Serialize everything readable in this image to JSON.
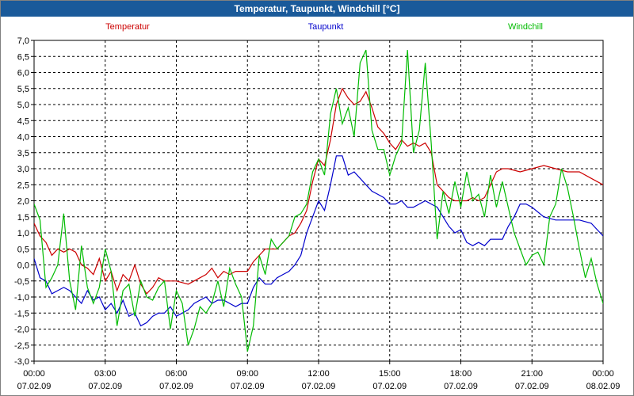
{
  "window": {
    "title": "Temperatur, Taupunkt, Windchill [°C]"
  },
  "chart_data": {
    "type": "line",
    "title": "Temperatur, Taupunkt, Windchill [°C]",
    "ylim": [
      -3.0,
      7.0
    ],
    "ytick_step": 0.5,
    "y_ticks": [
      "7,0",
      "6,5",
      "6,0",
      "5,5",
      "5,0",
      "4,5",
      "4,0",
      "3,5",
      "3,0",
      "2,5",
      "2,0",
      "1,5",
      "1,0",
      "0,5",
      "0,0",
      "-0,5",
      "-1,0",
      "-1,5",
      "-2,0",
      "-2,5",
      "-3,0"
    ],
    "x_unit": "hours since 07.02.09 00:00",
    "xlim": [
      0,
      24
    ],
    "x_ticks": [
      {
        "time": "00:00",
        "date": "07.02.09"
      },
      {
        "time": "03:00",
        "date": "07.02.09"
      },
      {
        "time": "06:00",
        "date": "07.02.09"
      },
      {
        "time": "09:00",
        "date": "07.02.09"
      },
      {
        "time": "12:00",
        "date": "07.02.09"
      },
      {
        "time": "15:00",
        "date": "07.02.09"
      },
      {
        "time": "18:00",
        "date": "07.02.09"
      },
      {
        "time": "21:00",
        "date": "07.02.09"
      },
      {
        "time": "00:00",
        "date": "08.02.09"
      }
    ],
    "grid": true,
    "legend_placement": "top",
    "series": [
      {
        "name": "Temperatur",
        "color": "#cc0000",
        "points": [
          [
            0,
            1.3
          ],
          [
            0.25,
            0.9
          ],
          [
            0.5,
            0.7
          ],
          [
            0.75,
            0.3
          ],
          [
            1,
            0.5
          ],
          [
            1.25,
            0.4
          ],
          [
            1.5,
            0.5
          ],
          [
            1.75,
            0.4
          ],
          [
            2,
            0.0
          ],
          [
            2.25,
            -0.1
          ],
          [
            2.5,
            -0.3
          ],
          [
            2.75,
            0.2
          ],
          [
            3,
            -0.5
          ],
          [
            3.25,
            -0.2
          ],
          [
            3.5,
            -0.8
          ],
          [
            3.75,
            -0.3
          ],
          [
            4,
            -0.5
          ],
          [
            4.25,
            0.0
          ],
          [
            4.5,
            -0.6
          ],
          [
            4.75,
            -0.9
          ],
          [
            5,
            -0.7
          ],
          [
            5.25,
            -0.4
          ],
          [
            5.5,
            -0.5
          ],
          [
            6,
            -0.5
          ],
          [
            6.5,
            -0.6
          ],
          [
            7,
            -0.4
          ],
          [
            7.25,
            -0.3
          ],
          [
            7.5,
            -0.1
          ],
          [
            7.75,
            -0.4
          ],
          [
            8,
            -0.2
          ],
          [
            8.25,
            -0.3
          ],
          [
            8.5,
            -0.2
          ],
          [
            9,
            -0.2
          ],
          [
            9.25,
            0.1
          ],
          [
            9.5,
            0.3
          ],
          [
            9.75,
            0.5
          ],
          [
            10,
            0.5
          ],
          [
            10.25,
            0.5
          ],
          [
            10.5,
            0.7
          ],
          [
            10.75,
            0.9
          ],
          [
            11,
            1.0
          ],
          [
            11.25,
            1.3
          ],
          [
            11.5,
            1.7
          ],
          [
            11.75,
            2.6
          ],
          [
            12,
            3.3
          ],
          [
            12.25,
            3.1
          ],
          [
            12.5,
            3.9
          ],
          [
            12.75,
            5.0
          ],
          [
            13,
            5.5
          ],
          [
            13.25,
            5.2
          ],
          [
            13.5,
            5.0
          ],
          [
            13.75,
            5.1
          ],
          [
            14,
            5.4
          ],
          [
            14.25,
            4.9
          ],
          [
            14.5,
            4.3
          ],
          [
            14.75,
            4.1
          ],
          [
            15,
            3.8
          ],
          [
            15.25,
            3.6
          ],
          [
            15.5,
            3.9
          ],
          [
            15.75,
            3.7
          ],
          [
            16,
            3.8
          ],
          [
            16.25,
            3.7
          ],
          [
            16.5,
            3.8
          ],
          [
            16.75,
            3.5
          ],
          [
            17,
            2.5
          ],
          [
            17.25,
            2.3
          ],
          [
            17.5,
            2.1
          ],
          [
            17.75,
            2.0
          ],
          [
            18,
            2.0
          ],
          [
            18.25,
            2.0
          ],
          [
            18.5,
            2.1
          ],
          [
            18.75,
            2.0
          ],
          [
            19,
            2.1
          ],
          [
            19.25,
            2.5
          ],
          [
            19.5,
            2.9
          ],
          [
            19.75,
            3.0
          ],
          [
            20,
            3.0
          ],
          [
            20.5,
            2.9
          ],
          [
            21,
            3.0
          ],
          [
            21.5,
            3.1
          ],
          [
            22,
            3.0
          ],
          [
            22.5,
            2.9
          ],
          [
            23,
            2.9
          ],
          [
            23.5,
            2.7
          ],
          [
            24,
            2.5
          ]
        ]
      },
      {
        "name": "Taupunkt",
        "color": "#0000cc",
        "points": [
          [
            0,
            0.2
          ],
          [
            0.25,
            -0.4
          ],
          [
            0.5,
            -0.5
          ],
          [
            0.75,
            -0.9
          ],
          [
            1,
            -0.8
          ],
          [
            1.25,
            -0.7
          ],
          [
            1.5,
            -0.8
          ],
          [
            1.75,
            -1.0
          ],
          [
            2,
            -1.2
          ],
          [
            2.25,
            -0.8
          ],
          [
            2.5,
            -1.1
          ],
          [
            2.75,
            -1.0
          ],
          [
            3,
            -1.4
          ],
          [
            3.25,
            -1.2
          ],
          [
            3.5,
            -1.5
          ],
          [
            3.75,
            -1.1
          ],
          [
            4,
            -1.6
          ],
          [
            4.25,
            -1.5
          ],
          [
            4.5,
            -1.9
          ],
          [
            4.75,
            -1.8
          ],
          [
            5,
            -1.6
          ],
          [
            5.25,
            -1.5
          ],
          [
            5.5,
            -1.5
          ],
          [
            5.75,
            -1.3
          ],
          [
            6,
            -1.6
          ],
          [
            6.25,
            -1.5
          ],
          [
            6.5,
            -1.4
          ],
          [
            6.75,
            -1.2
          ],
          [
            7,
            -1.1
          ],
          [
            7.25,
            -1.0
          ],
          [
            7.5,
            -1.2
          ],
          [
            7.75,
            -1.1
          ],
          [
            8,
            -1.1
          ],
          [
            8.25,
            -1.2
          ],
          [
            8.5,
            -1.3
          ],
          [
            8.75,
            -1.2
          ],
          [
            9,
            -1.2
          ],
          [
            9.25,
            -0.7
          ],
          [
            9.5,
            -0.4
          ],
          [
            9.75,
            -0.6
          ],
          [
            10,
            -0.6
          ],
          [
            10.25,
            -0.4
          ],
          [
            10.5,
            -0.3
          ],
          [
            10.75,
            -0.2
          ],
          [
            11,
            0.0
          ],
          [
            11.25,
            0.3
          ],
          [
            11.5,
            1.0
          ],
          [
            11.75,
            1.5
          ],
          [
            12,
            2.0
          ],
          [
            12.25,
            1.7
          ],
          [
            12.5,
            2.5
          ],
          [
            12.75,
            3.4
          ],
          [
            13,
            3.4
          ],
          [
            13.25,
            2.8
          ],
          [
            13.5,
            2.9
          ],
          [
            13.75,
            2.7
          ],
          [
            14,
            2.5
          ],
          [
            14.25,
            2.3
          ],
          [
            14.5,
            2.2
          ],
          [
            14.75,
            2.1
          ],
          [
            15,
            1.9
          ],
          [
            15.25,
            1.9
          ],
          [
            15.5,
            2.0
          ],
          [
            15.75,
            1.8
          ],
          [
            16,
            1.8
          ],
          [
            16.25,
            1.9
          ],
          [
            16.5,
            2.0
          ],
          [
            16.75,
            1.9
          ],
          [
            17,
            1.8
          ],
          [
            17.25,
            1.5
          ],
          [
            17.5,
            1.2
          ],
          [
            17.75,
            1.0
          ],
          [
            18,
            1.1
          ],
          [
            18.25,
            0.7
          ],
          [
            18.5,
            0.6
          ],
          [
            18.75,
            0.7
          ],
          [
            19,
            0.6
          ],
          [
            19.25,
            0.8
          ],
          [
            19.5,
            0.8
          ],
          [
            19.75,
            0.8
          ],
          [
            20,
            1.2
          ],
          [
            20.25,
            1.5
          ],
          [
            20.5,
            1.9
          ],
          [
            20.75,
            1.9
          ],
          [
            21,
            1.8
          ],
          [
            21.5,
            1.5
          ],
          [
            22,
            1.4
          ],
          [
            22.5,
            1.4
          ],
          [
            23,
            1.4
          ],
          [
            23.5,
            1.3
          ],
          [
            24,
            0.9
          ]
        ]
      },
      {
        "name": "Windchill",
        "color": "#00bb00",
        "points": [
          [
            0,
            1.9
          ],
          [
            0.25,
            1.4
          ],
          [
            0.5,
            -0.7
          ],
          [
            0.75,
            -0.4
          ],
          [
            1,
            0.0
          ],
          [
            1.25,
            1.6
          ],
          [
            1.5,
            -0.5
          ],
          [
            1.75,
            -1.4
          ],
          [
            2,
            0.6
          ],
          [
            2.25,
            -0.7
          ],
          [
            2.5,
            -1.2
          ],
          [
            2.75,
            -0.7
          ],
          [
            3,
            0.5
          ],
          [
            3.25,
            -0.2
          ],
          [
            3.5,
            -1.9
          ],
          [
            3.75,
            -0.8
          ],
          [
            4,
            -0.6
          ],
          [
            4.25,
            -1.6
          ],
          [
            4.5,
            -0.5
          ],
          [
            4.75,
            -1.0
          ],
          [
            5,
            -1.1
          ],
          [
            5.25,
            -0.7
          ],
          [
            5.5,
            -0.5
          ],
          [
            5.75,
            -2.0
          ],
          [
            6,
            -0.8
          ],
          [
            6.25,
            -1.2
          ],
          [
            6.5,
            -2.5
          ],
          [
            6.75,
            -2.0
          ],
          [
            7,
            -1.3
          ],
          [
            7.25,
            -1.5
          ],
          [
            7.5,
            -1.2
          ],
          [
            7.75,
            -0.5
          ],
          [
            8,
            -1.3
          ],
          [
            8.25,
            -0.1
          ],
          [
            8.5,
            -0.6
          ],
          [
            8.75,
            -1.0
          ],
          [
            9,
            -2.7
          ],
          [
            9.25,
            -1.9
          ],
          [
            9.5,
            0.3
          ],
          [
            9.75,
            -0.3
          ],
          [
            10,
            0.8
          ],
          [
            10.25,
            0.5
          ],
          [
            10.5,
            0.7
          ],
          [
            10.75,
            0.9
          ],
          [
            11,
            1.5
          ],
          [
            11.25,
            1.6
          ],
          [
            11.5,
            1.9
          ],
          [
            11.75,
            2.9
          ],
          [
            12,
            3.3
          ],
          [
            12.25,
            2.8
          ],
          [
            12.5,
            4.7
          ],
          [
            12.75,
            5.5
          ],
          [
            13,
            4.4
          ],
          [
            13.25,
            4.9
          ],
          [
            13.5,
            4.0
          ],
          [
            13.75,
            6.3
          ],
          [
            14,
            6.7
          ],
          [
            14.25,
            4.2
          ],
          [
            14.5,
            3.6
          ],
          [
            14.75,
            3.6
          ],
          [
            15,
            2.8
          ],
          [
            15.25,
            3.4
          ],
          [
            15.5,
            3.8
          ],
          [
            15.75,
            6.7
          ],
          [
            16,
            3.5
          ],
          [
            16.25,
            4.2
          ],
          [
            16.5,
            6.3
          ],
          [
            16.75,
            3.8
          ],
          [
            17,
            0.8
          ],
          [
            17.25,
            2.3
          ],
          [
            17.5,
            1.6
          ],
          [
            17.75,
            2.6
          ],
          [
            18,
            1.8
          ],
          [
            18.25,
            2.9
          ],
          [
            18.5,
            2.0
          ],
          [
            18.75,
            2.2
          ],
          [
            19,
            1.5
          ],
          [
            19.25,
            2.8
          ],
          [
            19.5,
            1.8
          ],
          [
            19.75,
            2.6
          ],
          [
            20,
            1.8
          ],
          [
            20.25,
            1.0
          ],
          [
            20.5,
            0.5
          ],
          [
            20.75,
            0.0
          ],
          [
            21,
            0.3
          ],
          [
            21.25,
            0.4
          ],
          [
            21.5,
            0.0
          ],
          [
            21.75,
            1.5
          ],
          [
            22,
            1.9
          ],
          [
            22.25,
            3.0
          ],
          [
            22.5,
            2.4
          ],
          [
            22.75,
            1.5
          ],
          [
            23,
            0.5
          ],
          [
            23.25,
            -0.4
          ],
          [
            23.5,
            0.2
          ],
          [
            23.75,
            -0.6
          ],
          [
            24,
            -1.2
          ],
          [
            24.25,
            -1.4
          ],
          [
            24.5,
            -0.9
          ]
        ]
      }
    ]
  }
}
